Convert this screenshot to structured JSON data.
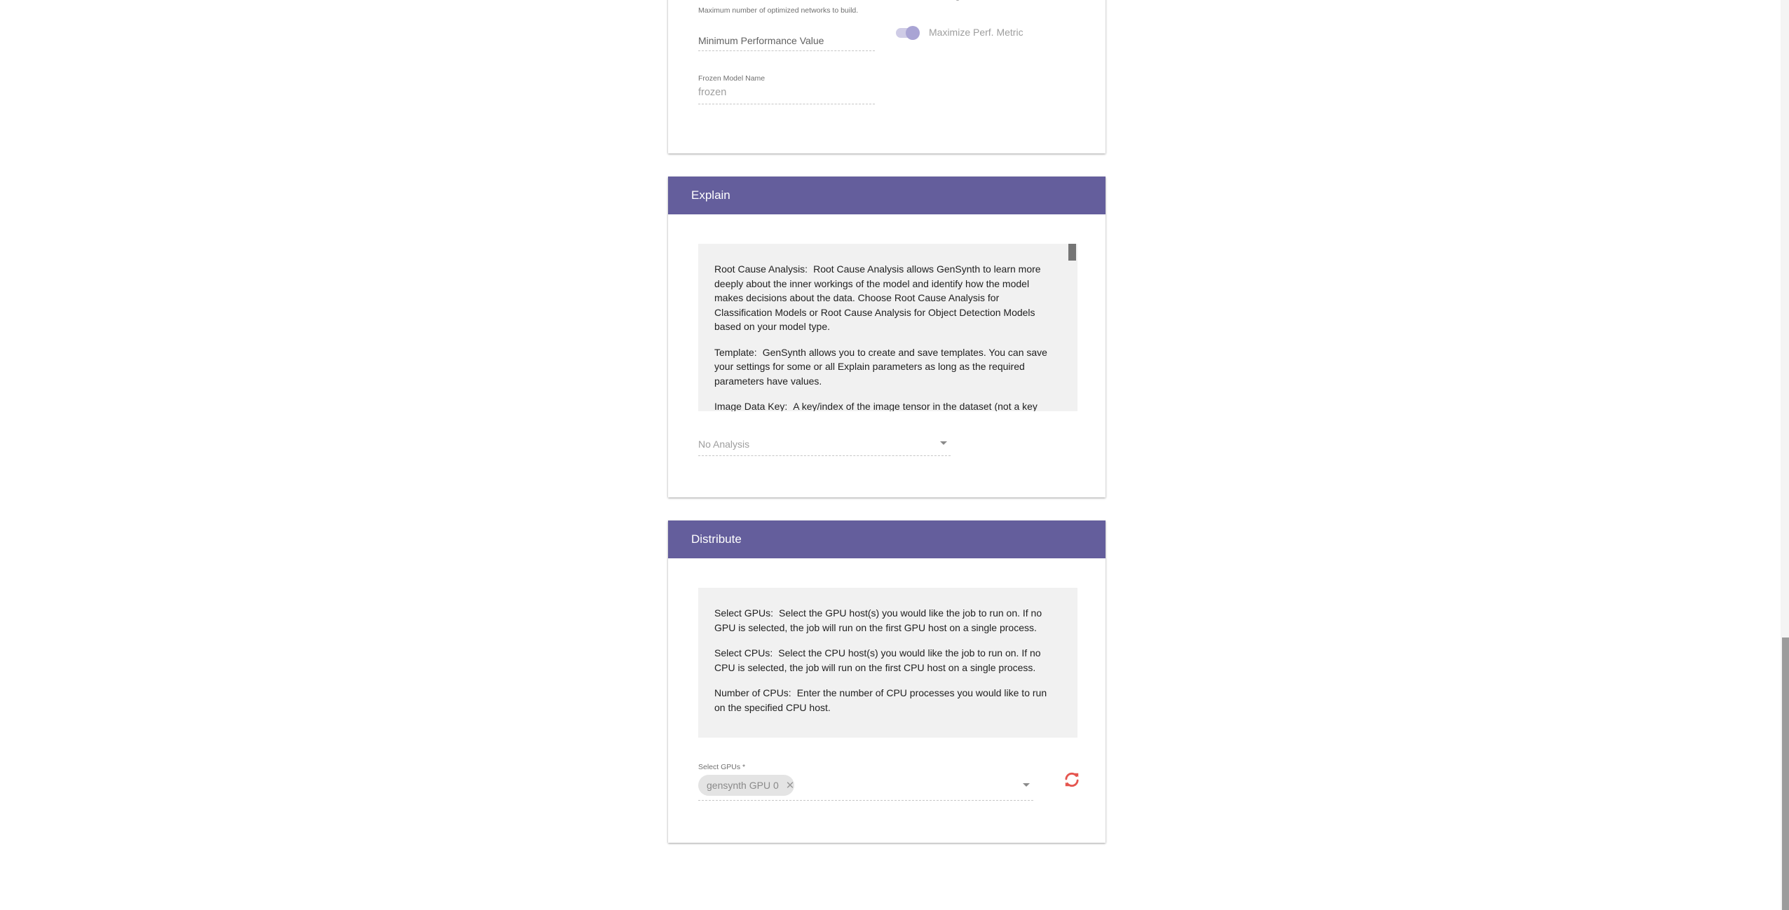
{
  "top_card": {
    "max_networks_help": "Maximum number of optimized networks to build.",
    "min_perf_placeholder": "Minimum Performance Value",
    "maximize_toggle_label": "Maximize Perf. Metric",
    "maximize_toggle_on": true,
    "frozen_model_label": "Frozen Model Name",
    "frozen_model_value": "frozen"
  },
  "explain": {
    "title": "Explain",
    "help": [
      {
        "term": "Root Cause Analysis:",
        "text": "Root Cause Analysis allows GenSynth to learn more deeply about the inner workings of the model and identify how the model makes decisions about the data. Choose Root Cause Analysis for Classification Models or Root Cause Analysis for Object Detection Models based on your model type."
      },
      {
        "term": "Template:",
        "text": "GenSynth allows you to create and save templates. You can save your settings for some or all Explain parameters as long as the required parameters have values."
      },
      {
        "term": "Image Data Key:",
        "text": "A key/index of the image tensor in the dataset (not a key"
      }
    ],
    "analysis_select_value": "No Analysis"
  },
  "distribute": {
    "title": "Distribute",
    "help": [
      {
        "term": "Select GPUs:",
        "text": "Select the GPU host(s) you would like the job to run on. If no GPU is selected, the job will run on the first GPU host on a single process."
      },
      {
        "term": "Select CPUs:",
        "text": "Select the CPU host(s) you would like the job to run on. If no CPU is selected, the job will run on the first CPU host on a single process."
      },
      {
        "term": "Number of CPUs:",
        "text": "Enter the number of CPU processes you would like to run on the specified CPU host."
      }
    ],
    "gpu_select_label": "Select GPUs *",
    "gpu_chips": [
      "gensynth GPU 0"
    ]
  },
  "colors": {
    "header": "#645e9c",
    "refresh_icon": "#e5554f"
  }
}
